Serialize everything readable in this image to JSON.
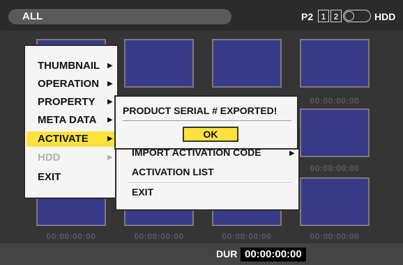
{
  "header": {
    "mode": "ALL",
    "p2_label": "P2",
    "slot1": "1",
    "slot2": "2",
    "hdd_label": "HDD"
  },
  "thumbnails": {
    "timecode": "00:00:00:00"
  },
  "main_menu": {
    "items": [
      {
        "label": "THUMBNAIL"
      },
      {
        "label": "OPERATION"
      },
      {
        "label": "PROPERTY"
      },
      {
        "label": "META DATA"
      },
      {
        "label": "ACTIVATE"
      },
      {
        "label": "HDD"
      },
      {
        "label": "EXIT"
      }
    ],
    "arrow": "▶"
  },
  "activate_submenu": {
    "items": [
      {
        "label": "IMPORT ACTIVATION CODE"
      },
      {
        "label": "ACTIVATION LIST"
      },
      {
        "label": "EXIT"
      }
    ],
    "arrow": "▶"
  },
  "dialog": {
    "message": "PRODUCT SERIAL # EXPORTED!",
    "ok_label": "OK"
  },
  "footer": {
    "dur_label": "DUR",
    "dur_value": "00:00:00:00"
  },
  "colors": {
    "highlight": "#ffe23c",
    "thumb_fill": "#3a3a8a"
  }
}
